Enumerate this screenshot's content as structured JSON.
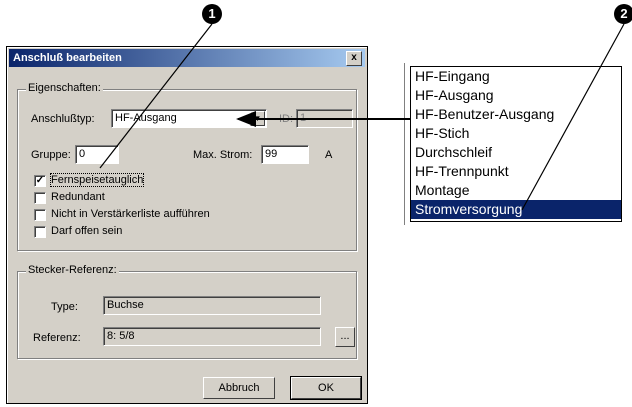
{
  "dialog": {
    "title": "Anschluß bearbeiten",
    "close_label": "x",
    "properties": {
      "legend": "Eigenschaften:",
      "type_label": "Anschlußtyp:",
      "type_value": "HF-Ausgang",
      "id_label": "ID:",
      "id_value": "1",
      "group_label": "Gruppe:",
      "group_value": "0",
      "maxcurrent_label": "Max. Strom:",
      "maxcurrent_value": "99",
      "unit": "A",
      "checkboxes": [
        {
          "label": "Fernspeisetauglich",
          "checked": true
        },
        {
          "label": "Redundant",
          "checked": false
        },
        {
          "label": "Nicht in Verstärkerliste aufführen",
          "checked": false
        },
        {
          "label": "Darf offen sein",
          "checked": false
        }
      ]
    },
    "plug": {
      "legend": "Stecker-Referenz:",
      "type_label": "Type:",
      "type_value": "Buchse",
      "ref_label": "Referenz:",
      "ref_value": "8: 5/8",
      "browse_label": "..."
    },
    "buttons": {
      "cancel": "Abbruch",
      "ok": "OK"
    }
  },
  "dropdown": {
    "items": [
      {
        "label": "HF-Eingang",
        "selected": false
      },
      {
        "label": "HF-Ausgang",
        "selected": false
      },
      {
        "label": "HF-Benutzer-Ausgang",
        "selected": false
      },
      {
        "label": "HF-Stich",
        "selected": false
      },
      {
        "label": "Durchschleif",
        "selected": false
      },
      {
        "label": "HF-Trennpunkt",
        "selected": false
      },
      {
        "label": "Montage",
        "selected": false
      },
      {
        "label": "Stromversorgung",
        "selected": true
      }
    ]
  },
  "callouts": {
    "one": "1",
    "two": "2"
  },
  "colors": {
    "selection": "#0a246a",
    "dialog_bg": "#d4d0c8"
  }
}
